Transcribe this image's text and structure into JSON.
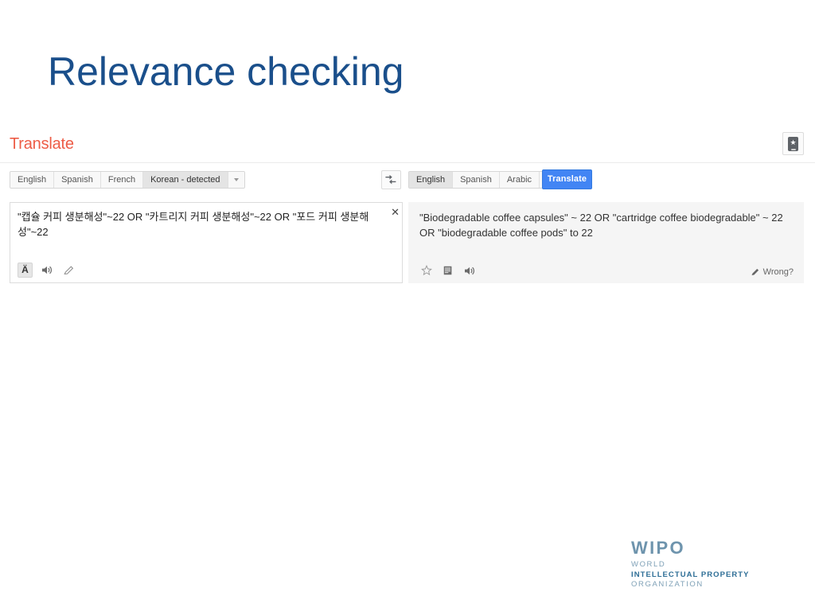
{
  "slide": {
    "title": "Relevance checking",
    "title_color": "#1A4F8B"
  },
  "translate_app": {
    "logo": "Translate",
    "logo_color": "#ed5c46",
    "mobile_app_button": {
      "icon": "mobile-phone-star-icon"
    },
    "source": {
      "tabs": [
        {
          "label": "English",
          "active": false
        },
        {
          "label": "Spanish",
          "active": false
        },
        {
          "label": "French",
          "active": false
        },
        {
          "label": "Korean - detected",
          "active": true
        }
      ],
      "more_languages_icon": "chevron-down-icon",
      "text": "\"캡슐 커피 생분해성\"~22 OR \"카트리지 커피 생분해성\"~22 OR \"포드 커피 생분해성\"~22",
      "clear_label": "✕",
      "tools": [
        {
          "name": "transliteration-toggle",
          "glyph": "Ä",
          "active": true
        },
        {
          "name": "listen-icon",
          "glyph": "speaker"
        },
        {
          "name": "edit-icon",
          "glyph": "pencil"
        }
      ]
    },
    "swap_button": {
      "icon": "swap-languages-icon"
    },
    "target": {
      "tabs": [
        {
          "label": "English",
          "active": true
        },
        {
          "label": "Spanish",
          "active": false
        },
        {
          "label": "Arabic",
          "active": false
        }
      ],
      "more_languages_icon": "chevron-down-icon",
      "translate_button_label": "Translate",
      "translate_button_color": "#4285f4",
      "text": "\"Biodegradable coffee capsules\" ~ 22 OR \"cartridge coffee biodegradable\" ~ 22 OR \"biodegradable coffee pods\" to 22",
      "tools": [
        {
          "name": "star-icon",
          "glyph": "star"
        },
        {
          "name": "copy-icon",
          "glyph": "copy"
        },
        {
          "name": "listen-icon",
          "glyph": "speaker"
        }
      ],
      "feedback_label": "Wrong?"
    }
  },
  "footer": {
    "wipo": {
      "acronym": "WIPO",
      "line1": "WORLD",
      "line2": "INTELLECTUAL PROPERTY",
      "line3": "ORGANIZATION",
      "color": "#2e6e96"
    }
  }
}
